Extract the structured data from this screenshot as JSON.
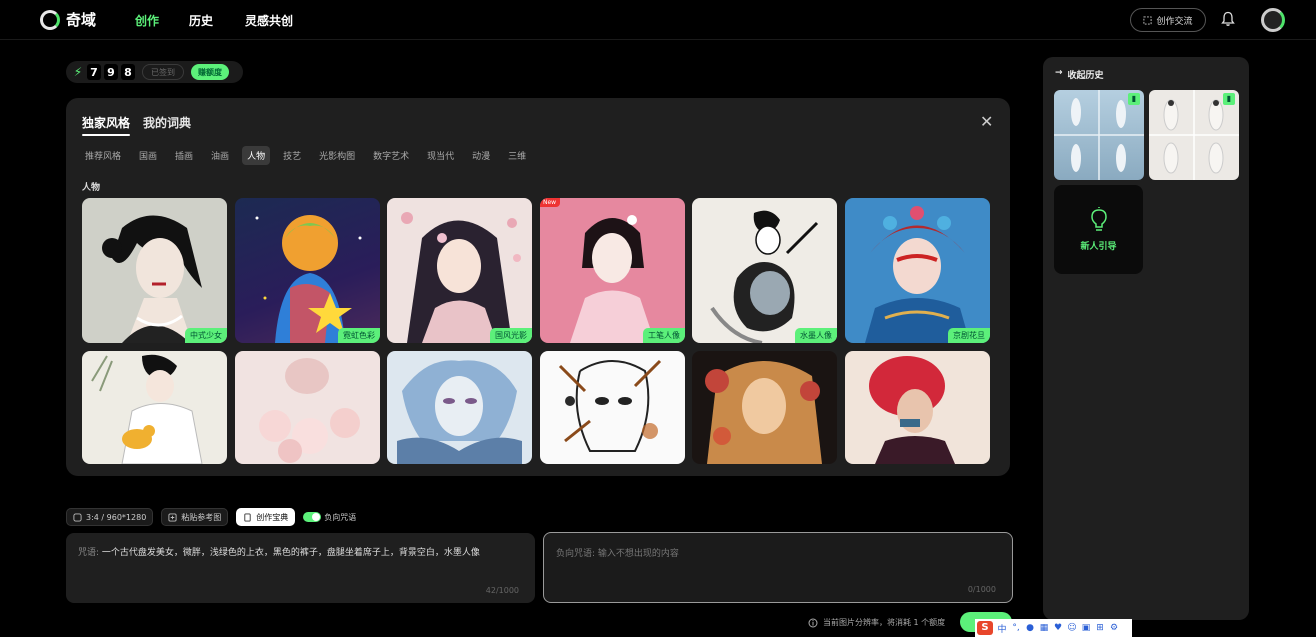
{
  "nav": {
    "logo_text": "奇域",
    "items": [
      "创作",
      "历史",
      "灵感共创"
    ],
    "exchange_label": "创作交流"
  },
  "points": {
    "digits": [
      "7",
      "9",
      "8"
    ],
    "signed_label": "已签到",
    "get_label": "赚额度"
  },
  "style_panel": {
    "tabs": [
      "独家风格",
      "我的词典"
    ],
    "categories": [
      "推荐风格",
      "国画",
      "插画",
      "油画",
      "人物",
      "技艺",
      "光影构图",
      "数字艺术",
      "现当代",
      "动漫",
      "三维"
    ],
    "active_category": "人物",
    "section_label": "人物",
    "new_badge": "New",
    "cards": [
      {
        "tag": "中式少女"
      },
      {
        "tag": "霓虹色彩"
      },
      {
        "tag": "国风光影"
      },
      {
        "tag": "工笔人像"
      },
      {
        "tag": "水墨人像"
      },
      {
        "tag": "京剧花旦"
      },
      {
        "tag": ""
      },
      {
        "tag": ""
      },
      {
        "tag": ""
      },
      {
        "tag": ""
      },
      {
        "tag": ""
      },
      {
        "tag": ""
      }
    ]
  },
  "history": {
    "title": "收起历史",
    "guide_label": "新人引导"
  },
  "toolbar": {
    "ratio_label": "3:4 / 960*1280",
    "ref_label": "粘贴参考图",
    "treasure_label": "创作宝典",
    "negative_label": "负向咒语"
  },
  "prompt": {
    "label": "咒语: ",
    "text": "一个古代盘发美女，微胖，浅绿色的上衣，黑色的裤子，盘腿坐着席子上，背景空白，水墨人像",
    "count": "42/1000"
  },
  "negative": {
    "placeholder": "负向咒语: 输入不想出现的内容",
    "count": "0/1000"
  },
  "footer": {
    "note": "当前图片分辨率，将消耗 1 个额度"
  },
  "ime": {
    "logo": "S",
    "lang": "中"
  },
  "colors": {
    "accent": "#5cf07a",
    "background": "#000000",
    "panel": "#1f1f1f"
  }
}
